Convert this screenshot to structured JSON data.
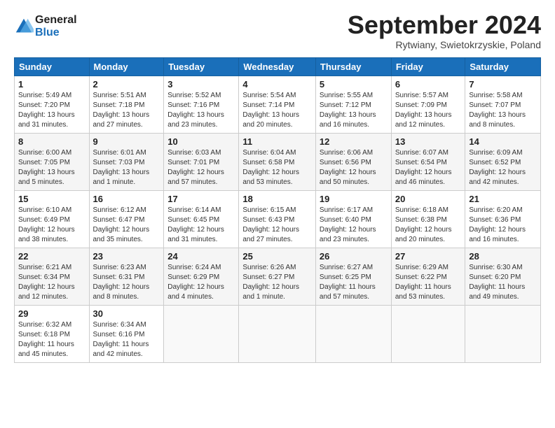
{
  "header": {
    "logo_line1": "General",
    "logo_line2": "Blue",
    "month": "September 2024",
    "location": "Rytwiany, Swietokrzyskie, Poland"
  },
  "weekdays": [
    "Sunday",
    "Monday",
    "Tuesday",
    "Wednesday",
    "Thursday",
    "Friday",
    "Saturday"
  ],
  "weeks": [
    [
      {
        "day": "1",
        "info": "Sunrise: 5:49 AM\nSunset: 7:20 PM\nDaylight: 13 hours\nand 31 minutes."
      },
      {
        "day": "2",
        "info": "Sunrise: 5:51 AM\nSunset: 7:18 PM\nDaylight: 13 hours\nand 27 minutes."
      },
      {
        "day": "3",
        "info": "Sunrise: 5:52 AM\nSunset: 7:16 PM\nDaylight: 13 hours\nand 23 minutes."
      },
      {
        "day": "4",
        "info": "Sunrise: 5:54 AM\nSunset: 7:14 PM\nDaylight: 13 hours\nand 20 minutes."
      },
      {
        "day": "5",
        "info": "Sunrise: 5:55 AM\nSunset: 7:12 PM\nDaylight: 13 hours\nand 16 minutes."
      },
      {
        "day": "6",
        "info": "Sunrise: 5:57 AM\nSunset: 7:09 PM\nDaylight: 13 hours\nand 12 minutes."
      },
      {
        "day": "7",
        "info": "Sunrise: 5:58 AM\nSunset: 7:07 PM\nDaylight: 13 hours\nand 8 minutes."
      }
    ],
    [
      {
        "day": "8",
        "info": "Sunrise: 6:00 AM\nSunset: 7:05 PM\nDaylight: 13 hours\nand 5 minutes."
      },
      {
        "day": "9",
        "info": "Sunrise: 6:01 AM\nSunset: 7:03 PM\nDaylight: 13 hours\nand 1 minute."
      },
      {
        "day": "10",
        "info": "Sunrise: 6:03 AM\nSunset: 7:01 PM\nDaylight: 12 hours\nand 57 minutes."
      },
      {
        "day": "11",
        "info": "Sunrise: 6:04 AM\nSunset: 6:58 PM\nDaylight: 12 hours\nand 53 minutes."
      },
      {
        "day": "12",
        "info": "Sunrise: 6:06 AM\nSunset: 6:56 PM\nDaylight: 12 hours\nand 50 minutes."
      },
      {
        "day": "13",
        "info": "Sunrise: 6:07 AM\nSunset: 6:54 PM\nDaylight: 12 hours\nand 46 minutes."
      },
      {
        "day": "14",
        "info": "Sunrise: 6:09 AM\nSunset: 6:52 PM\nDaylight: 12 hours\nand 42 minutes."
      }
    ],
    [
      {
        "day": "15",
        "info": "Sunrise: 6:10 AM\nSunset: 6:49 PM\nDaylight: 12 hours\nand 38 minutes."
      },
      {
        "day": "16",
        "info": "Sunrise: 6:12 AM\nSunset: 6:47 PM\nDaylight: 12 hours\nand 35 minutes."
      },
      {
        "day": "17",
        "info": "Sunrise: 6:14 AM\nSunset: 6:45 PM\nDaylight: 12 hours\nand 31 minutes."
      },
      {
        "day": "18",
        "info": "Sunrise: 6:15 AM\nSunset: 6:43 PM\nDaylight: 12 hours\nand 27 minutes."
      },
      {
        "day": "19",
        "info": "Sunrise: 6:17 AM\nSunset: 6:40 PM\nDaylight: 12 hours\nand 23 minutes."
      },
      {
        "day": "20",
        "info": "Sunrise: 6:18 AM\nSunset: 6:38 PM\nDaylight: 12 hours\nand 20 minutes."
      },
      {
        "day": "21",
        "info": "Sunrise: 6:20 AM\nSunset: 6:36 PM\nDaylight: 12 hours\nand 16 minutes."
      }
    ],
    [
      {
        "day": "22",
        "info": "Sunrise: 6:21 AM\nSunset: 6:34 PM\nDaylight: 12 hours\nand 12 minutes."
      },
      {
        "day": "23",
        "info": "Sunrise: 6:23 AM\nSunset: 6:31 PM\nDaylight: 12 hours\nand 8 minutes."
      },
      {
        "day": "24",
        "info": "Sunrise: 6:24 AM\nSunset: 6:29 PM\nDaylight: 12 hours\nand 4 minutes."
      },
      {
        "day": "25",
        "info": "Sunrise: 6:26 AM\nSunset: 6:27 PM\nDaylight: 12 hours\nand 1 minute."
      },
      {
        "day": "26",
        "info": "Sunrise: 6:27 AM\nSunset: 6:25 PM\nDaylight: 11 hours\nand 57 minutes."
      },
      {
        "day": "27",
        "info": "Sunrise: 6:29 AM\nSunset: 6:22 PM\nDaylight: 11 hours\nand 53 minutes."
      },
      {
        "day": "28",
        "info": "Sunrise: 6:30 AM\nSunset: 6:20 PM\nDaylight: 11 hours\nand 49 minutes."
      }
    ],
    [
      {
        "day": "29",
        "info": "Sunrise: 6:32 AM\nSunset: 6:18 PM\nDaylight: 11 hours\nand 45 minutes."
      },
      {
        "day": "30",
        "info": "Sunrise: 6:34 AM\nSunset: 6:16 PM\nDaylight: 11 hours\nand 42 minutes."
      },
      {
        "day": "",
        "info": ""
      },
      {
        "day": "",
        "info": ""
      },
      {
        "day": "",
        "info": ""
      },
      {
        "day": "",
        "info": ""
      },
      {
        "day": "",
        "info": ""
      }
    ]
  ]
}
